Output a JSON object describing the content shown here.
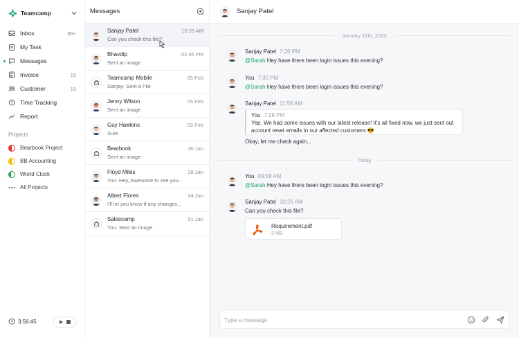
{
  "workspace": {
    "name": "Teamcamp"
  },
  "sidebar": {
    "items": [
      {
        "label": "Inbox",
        "count": "99+",
        "icon": "inbox-icon"
      },
      {
        "label": "My Task",
        "count": "",
        "icon": "clipboard-icon"
      },
      {
        "label": "Messages",
        "count": "",
        "icon": "chat-icon",
        "active": true
      },
      {
        "label": "Invoice",
        "count": "15",
        "icon": "invoice-icon"
      },
      {
        "label": "Customer",
        "count": "15",
        "icon": "users-icon"
      },
      {
        "label": "Time Tracking",
        "count": "",
        "icon": "clock-icon"
      },
      {
        "label": "Report",
        "count": "",
        "icon": "chart-icon"
      }
    ],
    "projects_label": "Projects",
    "projects": [
      {
        "label": "Bearbook Project",
        "color": "#e03131"
      },
      {
        "label": "BB Accounting",
        "color": "#f2b705"
      },
      {
        "label": "World Clock",
        "color": "#2f9e44"
      },
      {
        "label": "All Projects",
        "icon": "more-icon"
      }
    ],
    "timer": "3:56:45"
  },
  "conversations": {
    "title": "Messages",
    "items": [
      {
        "name": "Sanjay Patel",
        "time": "10:26 AM",
        "preview": "Can you check this file?",
        "active": true
      },
      {
        "name": "Bhavdip",
        "time": "02:45 PM",
        "preview": "Sent an image"
      },
      {
        "name": "Teamcamp Mobile",
        "time": "05 Feb",
        "preview": "Sanjay: Sent a File",
        "group": true
      },
      {
        "name": "Jenny Wilson",
        "time": "05 Feb",
        "preview": "Sent an image"
      },
      {
        "name": "Guy Hawkins",
        "time": "03 Feb",
        "preview": "Sure"
      },
      {
        "name": "Bearbook",
        "time": "30 Jan",
        "preview": "Sent an image",
        "group": true
      },
      {
        "name": "Floyd Miles",
        "time": "28 Jan",
        "preview": "You: Hey, Awesome to see you..."
      },
      {
        "name": "Albert Flores",
        "time": "04 Jan",
        "preview": "I'll let you know if any changes..."
      },
      {
        "name": "Salescamp",
        "time": "01 Jan",
        "preview": "You: Sent an image",
        "group": true
      }
    ]
  },
  "chat": {
    "contact": "Sanjay Patel",
    "date_divider_1": "January 31th, 2023",
    "date_divider_2": "Today",
    "messages": [
      {
        "author": "Sanjay Patel",
        "time": "7:26 PM",
        "mention": "@Sarah",
        "text": " Hey have there been login issues this evening?"
      },
      {
        "author": "You",
        "time": "7:30 PM",
        "mention": "@Sarah",
        "text": " Hey have there been login issues this evening?"
      },
      {
        "author": "Sanjay Patel",
        "time": "11:58 AM",
        "quote": {
          "author": "You",
          "time": "7:28 PM",
          "line1": "Yep, We had some issues with our latest release! It's all fixed now, we just sent out",
          "line2": "account reset emails to our affected customers 😎"
        },
        "text": "Okay, let me check again..."
      },
      {
        "author": "You",
        "time": "09:58 AM",
        "mention": "@Sarah",
        "text": " Hey have there been login issues this evening?"
      },
      {
        "author": "Sanjay Patel",
        "time": "10:26 AM",
        "text": "Can you check this file?",
        "file": {
          "name": "Requirement.pdf",
          "size": "3 MB"
        }
      }
    ],
    "composer_placeholder": "Type a message"
  },
  "colors": {
    "accent": "#1aa36b",
    "mention": "#1aa36b",
    "pdf": "#e8590c"
  }
}
